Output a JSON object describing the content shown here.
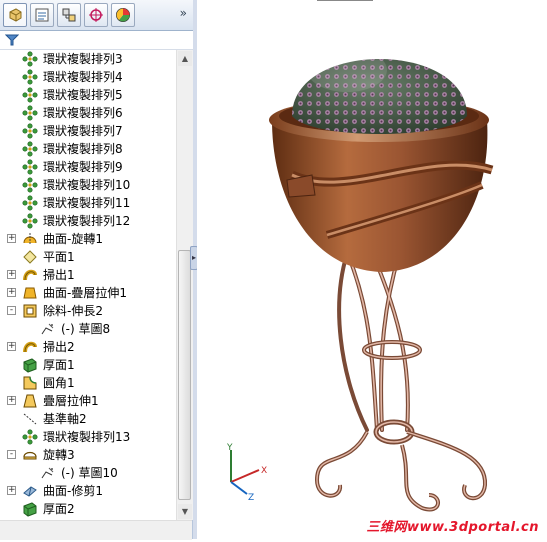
{
  "manager_tabs": [
    {
      "icon": "feature-manager-icon"
    },
    {
      "icon": "property-manager-icon"
    },
    {
      "icon": "configuration-manager-icon"
    },
    {
      "icon": "dimxpert-manager-icon"
    },
    {
      "icon": "display-manager-icon"
    }
  ],
  "more_label": "»",
  "tree_items": [
    {
      "label": "環狀複製排列3",
      "icon": "circular-pattern-icon",
      "indent": 1
    },
    {
      "label": "環狀複製排列4",
      "icon": "circular-pattern-icon",
      "indent": 1
    },
    {
      "label": "環狀複製排列5",
      "icon": "circular-pattern-icon",
      "indent": 1
    },
    {
      "label": "環狀複製排列6",
      "icon": "circular-pattern-icon",
      "indent": 1
    },
    {
      "label": "環狀複製排列7",
      "icon": "circular-pattern-icon",
      "indent": 1
    },
    {
      "label": "環狀複製排列8",
      "icon": "circular-pattern-icon",
      "indent": 1
    },
    {
      "label": "環狀複製排列9",
      "icon": "circular-pattern-icon",
      "indent": 1
    },
    {
      "label": "環狀複製排列10",
      "icon": "circular-pattern-icon",
      "indent": 1
    },
    {
      "label": "環狀複製排列11",
      "icon": "circular-pattern-icon",
      "indent": 1
    },
    {
      "label": "環狀複製排列12",
      "icon": "circular-pattern-icon",
      "indent": 1
    },
    {
      "label": "曲面-旋轉1",
      "icon": "surface-revolve-icon",
      "indent": 1,
      "expand": "+"
    },
    {
      "label": "平面1",
      "icon": "plane-icon",
      "indent": 1
    },
    {
      "label": "掃出1",
      "icon": "sweep-icon",
      "indent": 1,
      "expand": "+"
    },
    {
      "label": "曲面-疊層拉伸1",
      "icon": "surface-loft-icon",
      "indent": 1,
      "expand": "+"
    },
    {
      "label": "除料-伸長2",
      "icon": "cut-extrude-icon",
      "indent": 1,
      "expand": "-"
    },
    {
      "label": "(-) 草圖8",
      "icon": "sketch-icon",
      "indent": 2
    },
    {
      "label": "掃出2",
      "icon": "sweep-icon",
      "indent": 1,
      "expand": "+"
    },
    {
      "label": "厚面1",
      "icon": "thicken-icon",
      "indent": 1
    },
    {
      "label": "圓角1",
      "icon": "fillet-icon",
      "indent": 1
    },
    {
      "label": "疊層拉伸1",
      "icon": "loft-icon",
      "indent": 1,
      "expand": "+"
    },
    {
      "label": "基準軸2",
      "icon": "axis-icon",
      "indent": 1
    },
    {
      "label": "環狀複製排列13",
      "icon": "circular-pattern-icon",
      "indent": 1
    },
    {
      "label": "旋轉3",
      "icon": "revolve-icon",
      "indent": 1,
      "expand": "-"
    },
    {
      "label": "(-) 草圖10",
      "icon": "sketch-icon",
      "indent": 2
    },
    {
      "label": "曲面-修剪1",
      "icon": "surface-trim-icon",
      "indent": 1,
      "expand": "+"
    },
    {
      "label": "厚面2",
      "icon": "thicken-icon",
      "indent": 1
    }
  ],
  "triad": {
    "x": "X",
    "y": "Y",
    "z": "Z"
  },
  "watermark": "三维网www.3dportal.cn",
  "colors": {
    "bronze": "#8a4a2a",
    "panel_border": "#b7c6dc",
    "watermark": "#e4162b"
  }
}
